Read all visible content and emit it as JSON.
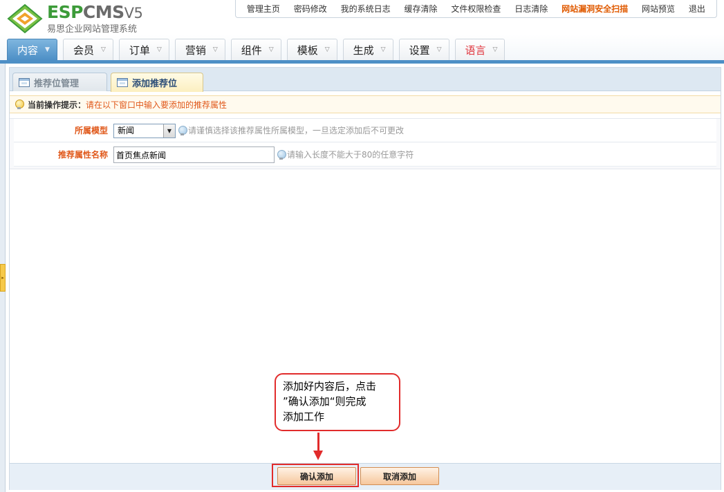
{
  "logo": {
    "brand_left": "ESP",
    "brand_right": "CMS",
    "version": "V5",
    "subtitle": "易思企业网站管理系统",
    "brand_colors": {
      "green": "#3c9b39",
      "gray": "#6b6b6b"
    }
  },
  "topnav": {
    "items": [
      {
        "label": "管理主页"
      },
      {
        "label": "密码修改"
      },
      {
        "label": "我的系统日志"
      },
      {
        "label": "缓存清除"
      },
      {
        "label": "文件权限检查"
      },
      {
        "label": "日志清除"
      },
      {
        "label": "网站漏洞安全扫描",
        "highlight": true
      },
      {
        "label": "网站预览"
      },
      {
        "label": "退出"
      }
    ]
  },
  "main_tabs": [
    {
      "label": "内容",
      "active": true
    },
    {
      "label": "会员"
    },
    {
      "label": "订单"
    },
    {
      "label": "营销"
    },
    {
      "label": "组件"
    },
    {
      "label": "模板"
    },
    {
      "label": "生成"
    },
    {
      "label": "设置"
    },
    {
      "label": "语言",
      "color": "#e0363e"
    }
  ],
  "sub_tabs": [
    {
      "label": "推荐位管理",
      "icon": "window-icon"
    },
    {
      "label": "添加推荐位",
      "icon": "window-icon",
      "active": true
    }
  ],
  "tip": {
    "icon": "lightbulb-icon",
    "label": "当前操作提示：",
    "text": "请在以下窗口中输入要添加的推荐属性"
  },
  "form": {
    "model": {
      "label": "所属模型",
      "selected": "新闻",
      "hint": "请谨慎选择该推荐属性所属模型，一旦选定添加后不可更改"
    },
    "name": {
      "label": "推荐属性名称",
      "value": "首页焦点新闻",
      "hint": "请输入长度不能大于80的任意字符"
    }
  },
  "callout": {
    "text": "添加好内容后，点击\n”确认添加“则完成\n添加工作",
    "color": "#e12b2b"
  },
  "buttons": {
    "confirm": "确认添加",
    "cancel": "取消添加"
  },
  "colors": {
    "accent_blue": "#4d8fc6",
    "hint_orange": "#e0581a"
  }
}
